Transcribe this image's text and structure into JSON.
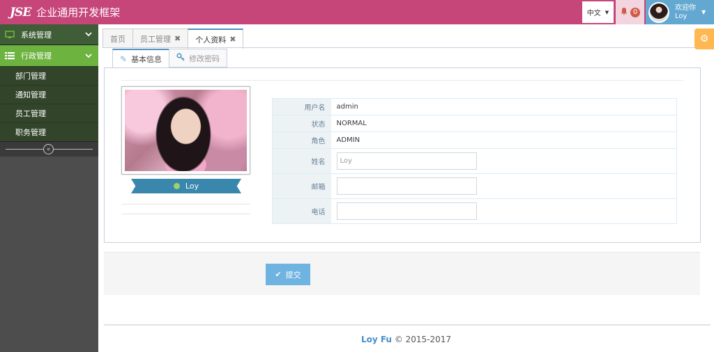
{
  "navbar": {
    "logo": "JSE",
    "title": "企业通用开发框架",
    "language": "中文",
    "notifications": "0",
    "welcome": "欢迎你",
    "username": "Loy",
    "colors": {
      "bar": "#c6467a",
      "user": "#62a8d1",
      "notify_bg": "#f2d5df"
    }
  },
  "sidebar": {
    "system_menu": "系统管理",
    "admin_menu": "行政管理",
    "sub_items": [
      "部门管理",
      "通知管理",
      "员工管理",
      "职务管理"
    ]
  },
  "tabs": [
    {
      "label": "首页"
    },
    {
      "label": "员工管理"
    },
    {
      "label": "个人资料"
    }
  ],
  "subtabs": {
    "basic_info": "基本信息",
    "change_password": "修改密码"
  },
  "profile": {
    "name": "Loy",
    "fields": {
      "username_label": "用户名",
      "username_value": "admin",
      "status_label": "状态",
      "status_value": "NORMAL",
      "role_label": "角色",
      "role_value": "ADMIN",
      "name_label": "姓名",
      "name_value": "Loy",
      "email_label": "邮箱",
      "phone_label": "电话"
    }
  },
  "form": {
    "submit_label": "提交"
  },
  "footer": {
    "author": "Loy Fu",
    "copyright": "© 2015-2017"
  }
}
